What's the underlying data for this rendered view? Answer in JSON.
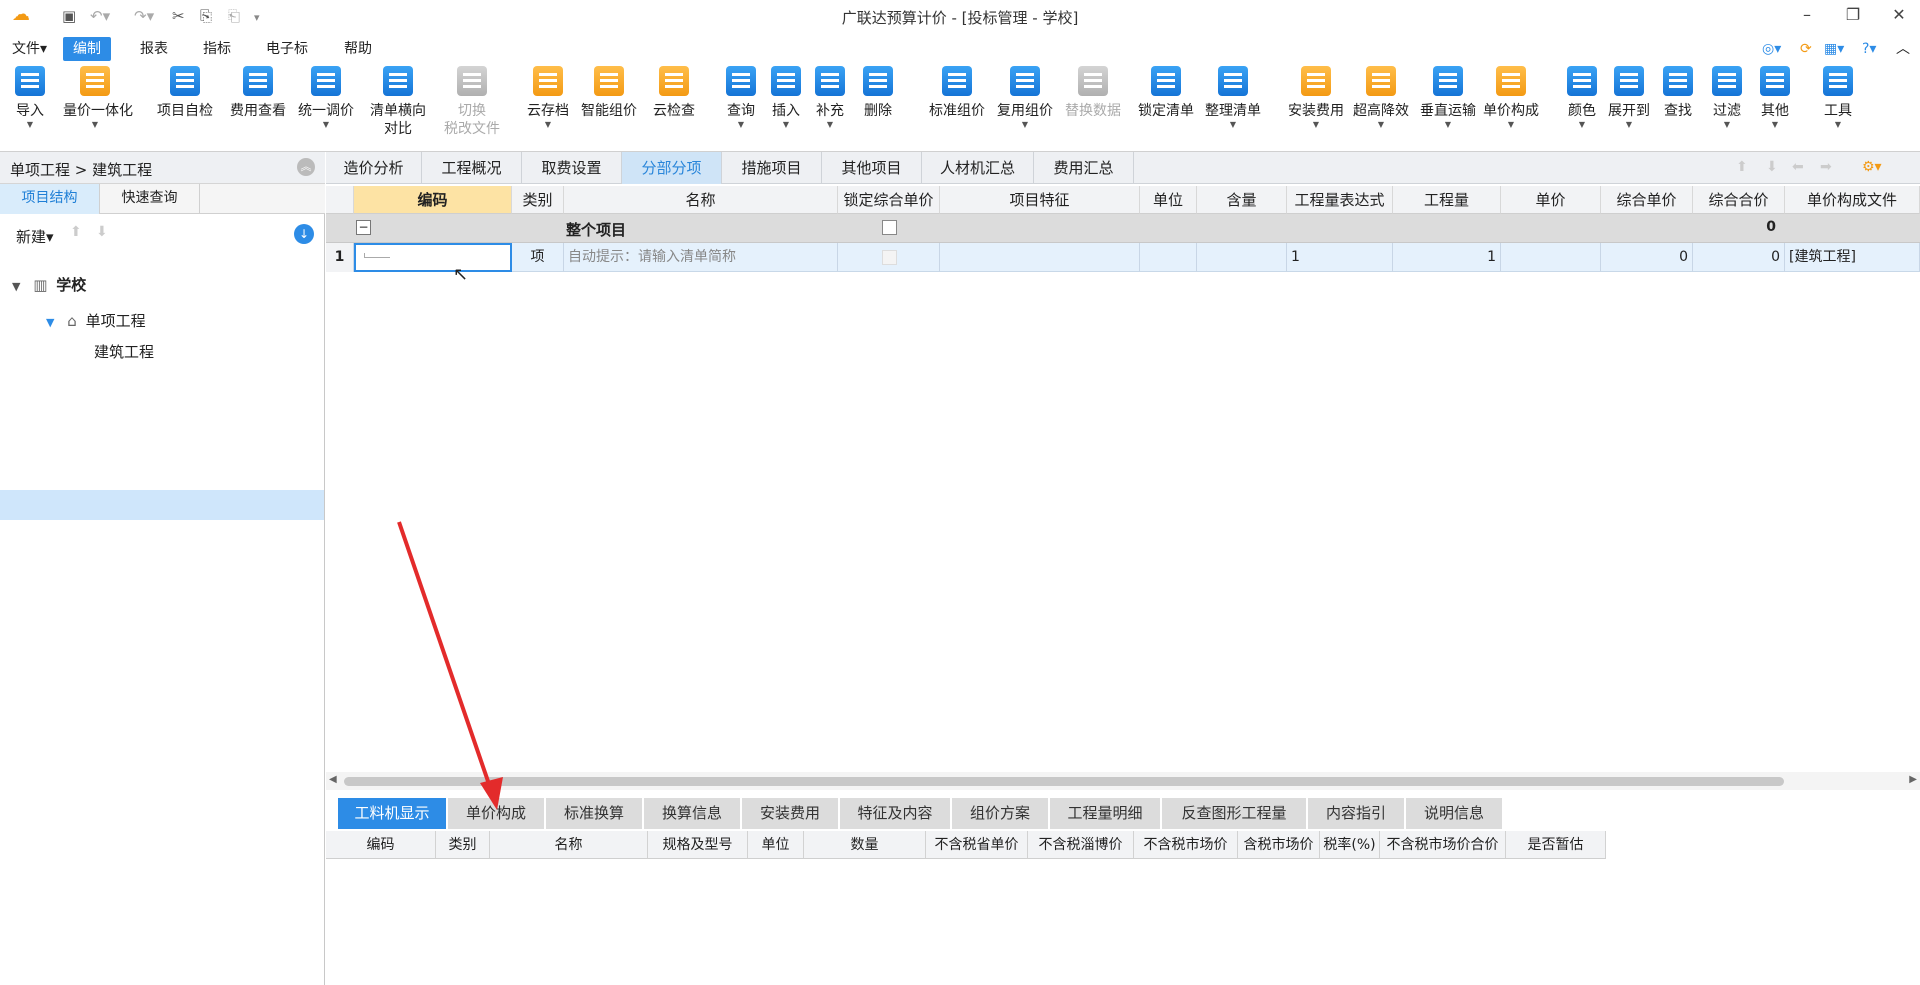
{
  "window": {
    "title": "广联达预算计价 - [投标管理 - 学校]"
  },
  "menu": [
    "文件",
    "编制",
    "报表",
    "指标",
    "电子标",
    "帮助"
  ],
  "ribbon": [
    {
      "label": "导入",
      "icon": "import-icon"
    },
    {
      "label": "量价一体化",
      "icon": "quantity-price-icon"
    },
    {
      "label": "项目自检",
      "icon": "self-check-icon"
    },
    {
      "label": "费用查看",
      "icon": "fee-view-icon"
    },
    {
      "label": "统一调价",
      "icon": "unified-price-icon"
    },
    {
      "label": "清单横向",
      "label2": "对比",
      "icon": "compare-icon"
    },
    {
      "label": "切换",
      "label2": "税改文件",
      "icon": "switch-tax-icon"
    },
    {
      "label": "云存档",
      "icon": "cloud-save-icon"
    },
    {
      "label": "智能组价",
      "icon": "smart-price-icon"
    },
    {
      "label": "云检查",
      "icon": "cloud-check-icon"
    },
    {
      "label": "查询",
      "icon": "query-icon"
    },
    {
      "label": "插入",
      "icon": "insert-icon"
    },
    {
      "label": "补充",
      "icon": "supplement-icon"
    },
    {
      "label": "删除",
      "icon": "delete-icon"
    },
    {
      "label": "标准组价",
      "icon": "standard-price-icon"
    },
    {
      "label": "复用组价",
      "icon": "reuse-price-icon"
    },
    {
      "label": "替换数据",
      "icon": "replace-data-icon"
    },
    {
      "label": "锁定清单",
      "icon": "lock-list-icon"
    },
    {
      "label": "整理清单",
      "icon": "organize-list-icon"
    },
    {
      "label": "安装费用",
      "icon": "install-fee-icon"
    },
    {
      "label": "超高降效",
      "icon": "high-rise-icon"
    },
    {
      "label": "垂直运输",
      "icon": "vertical-transport-icon"
    },
    {
      "label": "单价构成",
      "icon": "unit-price-icon"
    },
    {
      "label": "颜色",
      "icon": "color-icon"
    },
    {
      "label": "展开到",
      "icon": "expand-icon"
    },
    {
      "label": "查找",
      "icon": "find-icon"
    },
    {
      "label": "过滤",
      "icon": "filter-icon"
    },
    {
      "label": "其他",
      "icon": "other-icon"
    },
    {
      "label": "工具",
      "icon": "tools-icon"
    }
  ],
  "left": {
    "breadcrumb": "单项工程 > 建筑工程",
    "tabs": [
      "项目结构",
      "快速查询"
    ],
    "new_label": "新建",
    "tree": [
      "学校",
      "单项工程",
      "建筑工程"
    ]
  },
  "main_tabs": [
    "造价分析",
    "工程概况",
    "取费设置",
    "分部分项",
    "措施项目",
    "其他项目",
    "人材机汇总",
    "费用汇总"
  ],
  "grid": {
    "headers": [
      "编码",
      "类别",
      "名称",
      "锁定综合单价",
      "项目特征",
      "单位",
      "含量",
      "工程量表达式",
      "工程量",
      "单价",
      "综合单价",
      "综合合价",
      "单价构成文件"
    ],
    "group_row": {
      "name": "整个项目",
      "total": "0"
    },
    "row1": {
      "num": "1",
      "type": "项",
      "hint": "自动提示：请输入清单简称",
      "expr": "1",
      "qty": "1",
      "unit_total": "0",
      "total": "0",
      "file": "[建筑工程]"
    }
  },
  "bottom_tabs": [
    "工料机显示",
    "单价构成",
    "标准换算",
    "换算信息",
    "安装费用",
    "特征及内容",
    "组价方案",
    "工程量明细",
    "反查图形工程量",
    "内容指引",
    "说明信息"
  ],
  "bottom_headers": [
    "编码",
    "类别",
    "名称",
    "规格及型号",
    "单位",
    "数量",
    "不含税省单价",
    "不含税淄博价",
    "不含税市场价",
    "含税市场价",
    "税率(%)",
    "不含税市场价合价",
    "是否暂估"
  ]
}
